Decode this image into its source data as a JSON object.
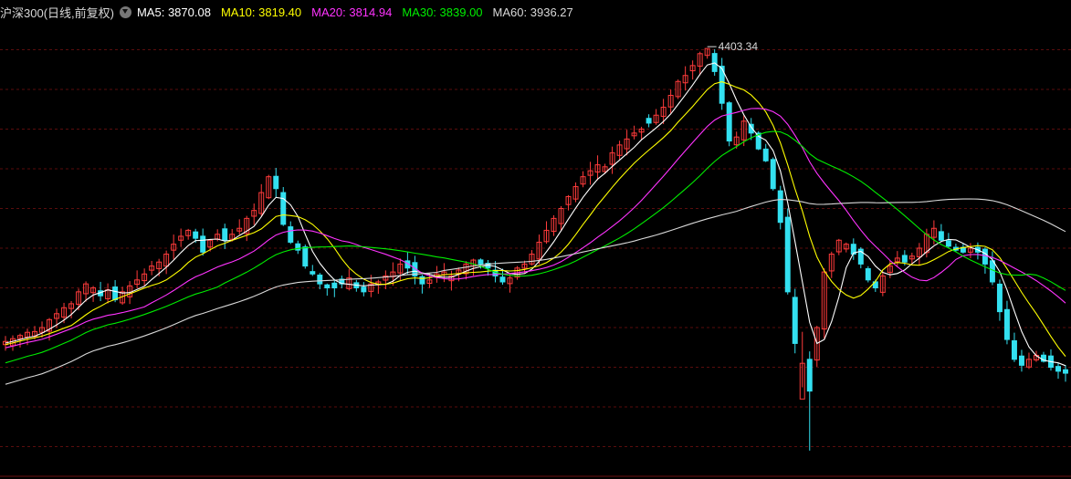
{
  "chart_data": {
    "type": "candlestick",
    "title": "沪深300(日线,前复权)",
    "ylim": [
      3330,
      4470
    ],
    "grid": "horizontal-dashed",
    "background": "#000000",
    "up_color": "#ff3b3b",
    "down_color": "#33e0f0",
    "peak_annotation": {
      "label": "4403.34",
      "index": 0
    },
    "ma_legend": [
      {
        "name": "MA5:",
        "value": "3870.08",
        "color": "#ffffff"
      },
      {
        "name": "MA10:",
        "value": "3819.40",
        "color": "#ffff00"
      },
      {
        "name": "MA20:",
        "value": "3814.94",
        "color": "#ff33ff"
      },
      {
        "name": "MA30:",
        "value": "3839.00",
        "color": "#00ee00"
      },
      {
        "name": "MA60:",
        "value": "3936.27",
        "color": "#d8d8d8"
      }
    ],
    "close_path": [
      3665,
      3672,
      3680,
      3688,
      3690,
      3700,
      3720,
      3735,
      3750,
      3760,
      3790,
      3810,
      3800,
      3780,
      3795,
      3770,
      3790,
      3805,
      3820,
      3835,
      3855,
      3865,
      3885,
      3910,
      3930,
      3945,
      3925,
      3890,
      3920,
      3935,
      3920,
      3935,
      3950,
      3975,
      3995,
      4040,
      4080,
      4050,
      3960,
      3915,
      3895,
      3855,
      3835,
      3810,
      3800,
      3800,
      3810,
      3825,
      3800,
      3790,
      3810,
      3815,
      3830,
      3840,
      3860,
      3850,
      3830,
      3810,
      3820,
      3835,
      3840,
      3830,
      3845,
      3860,
      3870,
      3860,
      3850,
      3830,
      3815,
      3825,
      3850,
      3860,
      3885,
      3915,
      3945,
      3975,
      4000,
      4030,
      4055,
      4080,
      4095,
      4110,
      4105,
      4140,
      4160,
      4175,
      4190,
      4200,
      4215,
      4235,
      4255,
      4285,
      4320,
      4335,
      4360,
      4390,
      4403,
      4345,
      4265,
      4170,
      4180,
      4220,
      4190,
      4150,
      4120,
      4050,
      3965,
      3790,
      3660,
      3565,
      3615,
      3700,
      3840,
      3885,
      3920,
      3910,
      3885,
      3860,
      3820,
      3800,
      3830,
      3855,
      3875,
      3865,
      3880,
      3900,
      3935,
      3950,
      3920,
      3905,
      3895,
      3890,
      3900,
      3890,
      3860,
      3815,
      3740,
      3670,
      3620,
      3605,
      3620,
      3630,
      3615,
      3600,
      3590,
      3585
    ]
  }
}
